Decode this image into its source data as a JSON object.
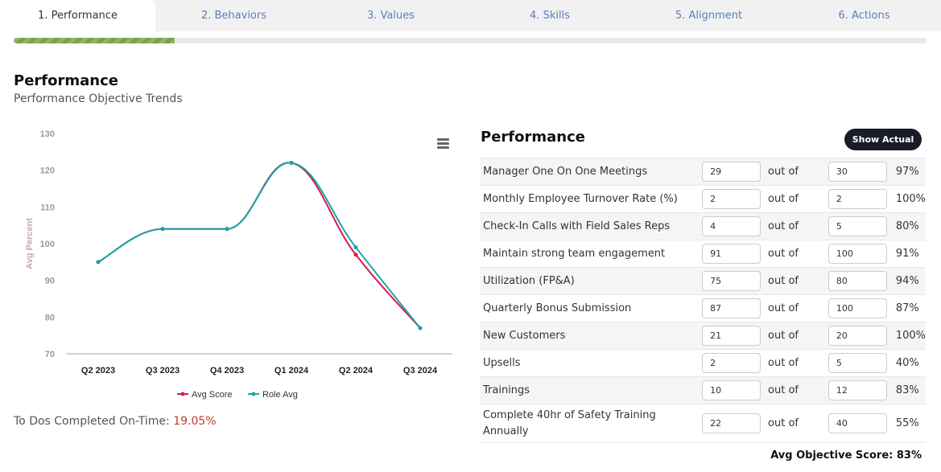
{
  "tabs": [
    {
      "label": "1. Performance",
      "active": true
    },
    {
      "label": "2. Behaviors",
      "active": false
    },
    {
      "label": "3. Values",
      "active": false
    },
    {
      "label": "4. Skills",
      "active": false
    },
    {
      "label": "5. Alignment",
      "active": false
    },
    {
      "label": "6. Actions",
      "active": false
    }
  ],
  "progress": {
    "percent": 17.6,
    "color": "#7aa14a"
  },
  "header": {
    "title": "Performance",
    "subtitle": "Performance Objective Trends"
  },
  "chart_menu_icon": "hamburger-menu-icon",
  "chart_data": {
    "type": "line",
    "title": "",
    "xlabel": "",
    "ylabel": "Avg Percent",
    "categories": [
      "Q2 2023",
      "Q3 2023",
      "Q4 2023",
      "Q1 2024",
      "Q2 2024",
      "Q3 2024"
    ],
    "ylim": [
      70,
      130
    ],
    "yticks": [
      70,
      80,
      90,
      100,
      110,
      120,
      130
    ],
    "grid": false,
    "legend": "bottom",
    "smooth": true,
    "series": [
      {
        "name": "Avg Score",
        "color": "#d81b50",
        "values": [
          95,
          104,
          104,
          122,
          97,
          77
        ]
      },
      {
        "name": "Role Avg",
        "color": "#1aa5a8",
        "values": [
          95,
          104,
          104,
          122,
          99,
          77
        ]
      }
    ]
  },
  "todo": {
    "label": "To Dos Completed On-Time:",
    "value": "19.05%"
  },
  "objectives": {
    "title": "Performance",
    "show_actual_label": "Show Actual",
    "out_of_label": "out of",
    "rows": [
      {
        "name": "Manager One On One Meetings",
        "actual": "29",
        "target": "30",
        "percent": "97%"
      },
      {
        "name": "Monthly Employee Turnover Rate (%)",
        "actual": "2",
        "target": "2",
        "percent": "100%"
      },
      {
        "name": "Check-In Calls with Field Sales Reps",
        "actual": "4",
        "target": "5",
        "percent": "80%"
      },
      {
        "name": "Maintain strong team engagement",
        "actual": "91",
        "target": "100",
        "percent": "91%"
      },
      {
        "name": "Utilization (FP&A)",
        "actual": "75",
        "target": "80",
        "percent": "94%"
      },
      {
        "name": "Quarterly Bonus Submission",
        "actual": "87",
        "target": "100",
        "percent": "87%"
      },
      {
        "name": "New Customers",
        "actual": "21",
        "target": "20",
        "percent": "100%"
      },
      {
        "name": "Upsells",
        "actual": "2",
        "target": "5",
        "percent": "40%"
      },
      {
        "name": "Trainings",
        "actual": "10",
        "target": "12",
        "percent": "83%"
      },
      {
        "name": "Complete 40hr of Safety Training Annually",
        "actual": "22",
        "target": "40",
        "percent": "55%"
      }
    ],
    "avg_label": "Avg Objective Score:",
    "avg_value": "83%"
  }
}
